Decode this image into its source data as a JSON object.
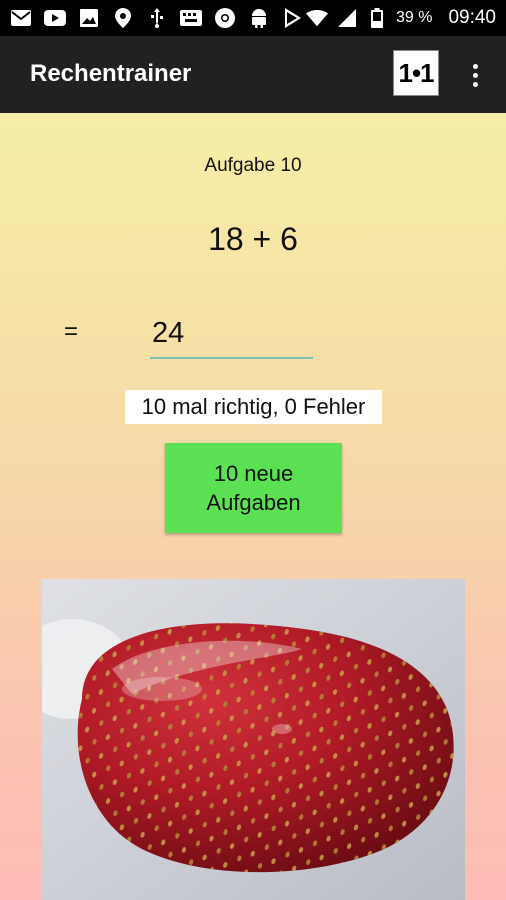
{
  "statusbar": {
    "icons": [
      "mail-icon",
      "youtube-icon",
      "image-icon",
      "location-icon",
      "usb-icon",
      "keyboard-icon",
      "chrome-icon",
      "android-icon",
      "play-store-icon",
      "wifi-icon",
      "signal-icon",
      "battery-icon"
    ],
    "battery": "39 %",
    "time": "09:40"
  },
  "appbar": {
    "title": "Rechentrainer",
    "logo_text": "1•1"
  },
  "main": {
    "task_label": "Aufgabe 10",
    "expression": "18 + 6",
    "equals": "=",
    "answer_value": "24",
    "result_text": "10 mal richtig, 0 Fehler",
    "new_tasks_button": "10 neue\nAufgaben"
  },
  "colors": {
    "appbar": "#212121",
    "button_green": "#5ce155",
    "underline": "#7fbfb8",
    "gradient_top": "#f5eea6",
    "gradient_bottom": "#fdbcb6"
  }
}
